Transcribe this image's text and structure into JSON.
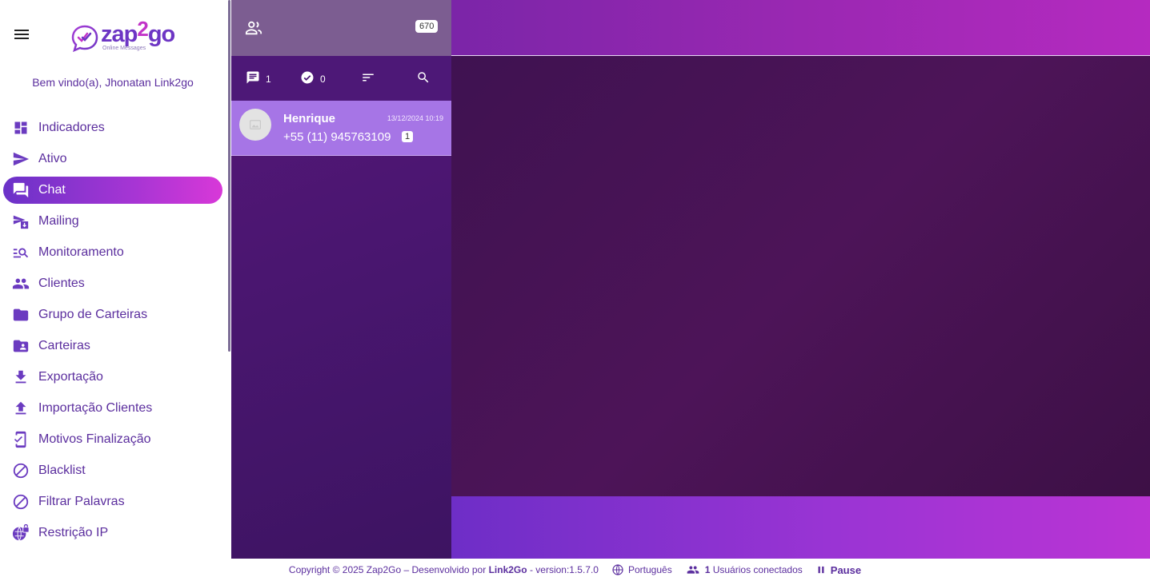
{
  "app": {
    "logo_main": "zap",
    "logo_two": "2",
    "logo_go": "go",
    "logo_sub": "Online Messages",
    "welcome": "Bem vindo(a), Jhonatan Link2go"
  },
  "sidebar": {
    "items": [
      {
        "label": "Indicadores",
        "icon": "dashboard-icon"
      },
      {
        "label": "Ativo",
        "icon": "send-icon"
      },
      {
        "label": "Chat",
        "icon": "forum-icon",
        "active": true
      },
      {
        "label": "Mailing",
        "icon": "mailing-icon"
      },
      {
        "label": "Monitoramento",
        "icon": "manage-search-icon"
      },
      {
        "label": "Clientes",
        "icon": "people-icon"
      },
      {
        "label": "Grupo de Carteiras",
        "icon": "folder-icon"
      },
      {
        "label": "Carteiras",
        "icon": "folder-shared-icon"
      },
      {
        "label": "Exportação",
        "icon": "download-icon"
      },
      {
        "label": "Importação Clientes",
        "icon": "upload-icon"
      },
      {
        "label": "Motivos Finalização",
        "icon": "mobile-check-icon"
      },
      {
        "label": "Blacklist",
        "icon": "block-icon"
      },
      {
        "label": "Filtrar Palavras",
        "icon": "block-icon"
      },
      {
        "label": "Restrição IP",
        "icon": "globe-lock-icon"
      }
    ]
  },
  "panel": {
    "users_count": "670",
    "tabs": {
      "open_count": "1",
      "closed_count": "0"
    },
    "contacts": [
      {
        "name": "Henrique",
        "time": "13/12/2024 10:19",
        "phone": "+55 (11) 945763109",
        "unread": "1"
      }
    ]
  },
  "footer": {
    "copyright": "Copyright © 2025 Zap2Go – Desenvolvido por",
    "company": "Link2Go",
    "version": "- version:1.5.7.0",
    "language": "Português",
    "users_connected_count": "1",
    "users_connected_label": "Usuários conectados",
    "pause": "Pause"
  },
  "colors": {
    "accent": "#5b2e9e",
    "active_gradient_start": "#6a32c8",
    "active_gradient_end": "#d838d8",
    "contact_highlight": "#a675e6"
  }
}
